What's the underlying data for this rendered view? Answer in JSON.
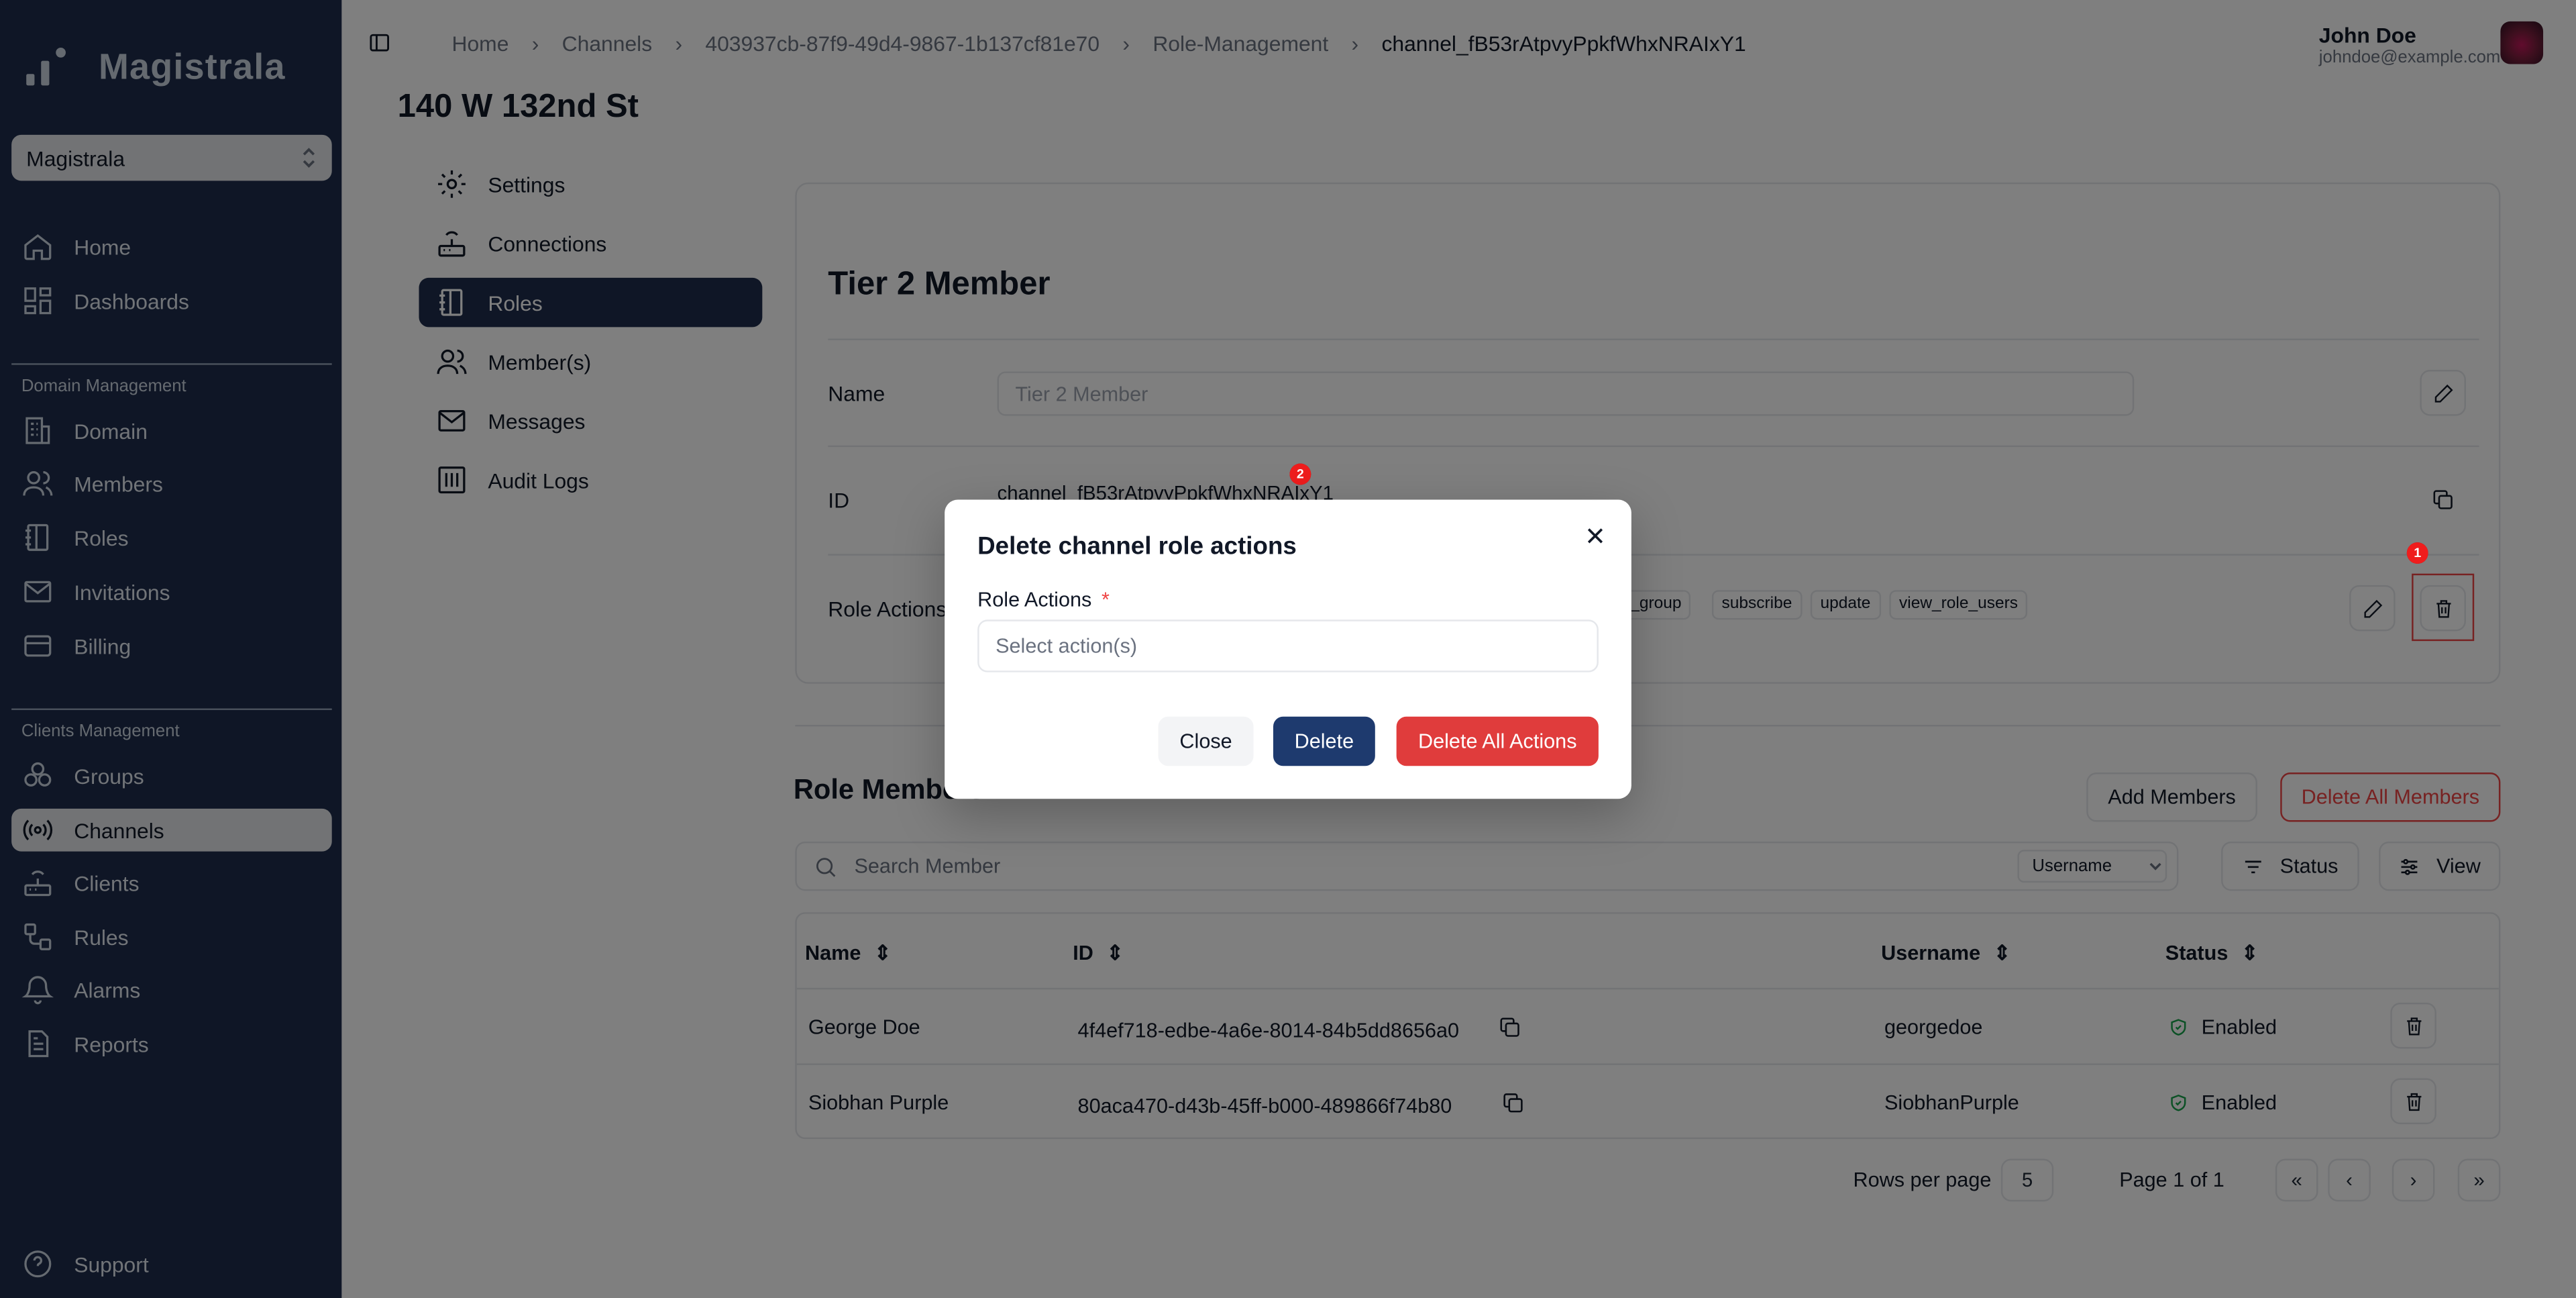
{
  "app": {
    "name": "Magistrala",
    "workspace": "Magistrala"
  },
  "nav": {
    "items": [
      "Home",
      "Dashboards"
    ],
    "domain_section": "Domain Management",
    "domain_items": [
      "Domain",
      "Members",
      "Roles",
      "Invitations",
      "Billing"
    ],
    "clients_section": "Clients Management",
    "clients_items": [
      "Groups",
      "Channels",
      "Clients",
      "Rules",
      "Alarms",
      "Reports"
    ],
    "support": "Support"
  },
  "breadcrumb": [
    "Home",
    "Channels",
    "403937cb-87f9-49d4-9867-1b137cf81e70",
    "Role-Management",
    "channel_fB53rAtpvyPpkfWhxNRAIxY1"
  ],
  "user": {
    "name": "John Doe",
    "email": "johndoe@example.com"
  },
  "page": {
    "title": "140 W 132nd St"
  },
  "tabs": [
    "Settings",
    "Connections",
    "Roles",
    "Member(s)",
    "Messages",
    "Audit Logs"
  ],
  "role": {
    "title": "Tier 2 Member",
    "name_label": "Name",
    "name_value": "Tier 2 Member",
    "id_label": "ID",
    "id_value": "channel_fB53rAtpvyPpkfWhxNRAIxY1",
    "actions_label": "Role Actions",
    "actions": [
      "nt_group",
      "subscribe",
      "update",
      "view_role_users"
    ]
  },
  "badges": [
    "1",
    "2"
  ],
  "members": {
    "title": "Role Members",
    "add_button": "Add Members",
    "delete_all_button": "Delete All Members",
    "search_placeholder": "Search Member",
    "search_field": "Username",
    "status_button": "Status",
    "view_button": "View",
    "columns": [
      "Name",
      "ID",
      "Username",
      "Status"
    ],
    "rows": [
      {
        "name": "George Doe",
        "id": "4f4ef718-edbe-4a6e-8014-84b5dd8656a0",
        "username": "georgedoe",
        "status": "Enabled"
      },
      {
        "name": "Siobhan Purple",
        "id": "80aca470-d43b-45ff-b000-489866f74b80",
        "username": "SiobhanPurple",
        "status": "Enabled"
      }
    ],
    "rows_per_page_label": "Rows per page",
    "rows_per_page": "5",
    "page_info": "Page 1 of 1"
  },
  "modal": {
    "title": "Delete channel role actions",
    "field_label": "Role Actions",
    "required_mark": "*",
    "placeholder": "Select action(s)",
    "close_button": "Close",
    "delete_button": "Delete",
    "delete_all_button": "Delete All Actions"
  },
  "colors": {
    "sidebar": "#1e2d4d",
    "accent": "#1e3a6e",
    "danger": "#e03c3c",
    "overlay": "rgba(0,0,0,0.5)"
  }
}
